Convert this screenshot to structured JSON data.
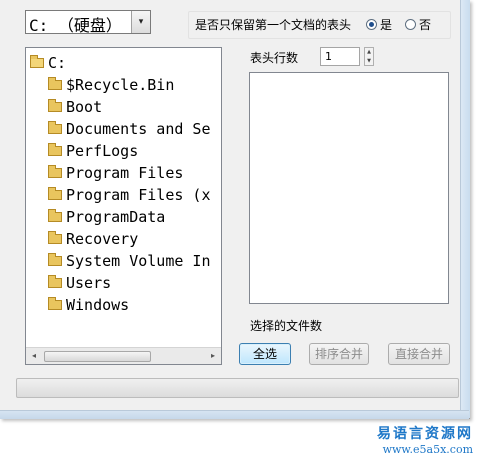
{
  "drive": {
    "selected": "C: （硬盘）",
    "arrow_glyph": "▾"
  },
  "header_option": {
    "label": "是否只保留第一个文档的表头",
    "yes": "是",
    "no": "否",
    "selected": "是"
  },
  "tree": {
    "root": "C:",
    "items": [
      "$Recycle.Bin",
      "Boot",
      "Documents and Se",
      "PerfLogs",
      "Program Files",
      "Program Files (x",
      "ProgramData",
      "Recovery",
      "System Volume In",
      "Users",
      "Windows"
    ],
    "scroll_left": "◂",
    "scroll_right": "▸"
  },
  "header_rows": {
    "label": "表头行数",
    "value": "1"
  },
  "file_count_label": "选择的文件数",
  "buttons": {
    "select_all": "全选",
    "sort_merge": "排序合并",
    "direct_merge": "直接合并"
  },
  "progress": {
    "value": 0
  },
  "watermark": {
    "name": "易语言资源网",
    "url": "www.e5a5x.com"
  },
  "icons": {
    "folder": "folder-icon",
    "folder_open": "folder-open-icon",
    "radio": "radio-icon"
  }
}
